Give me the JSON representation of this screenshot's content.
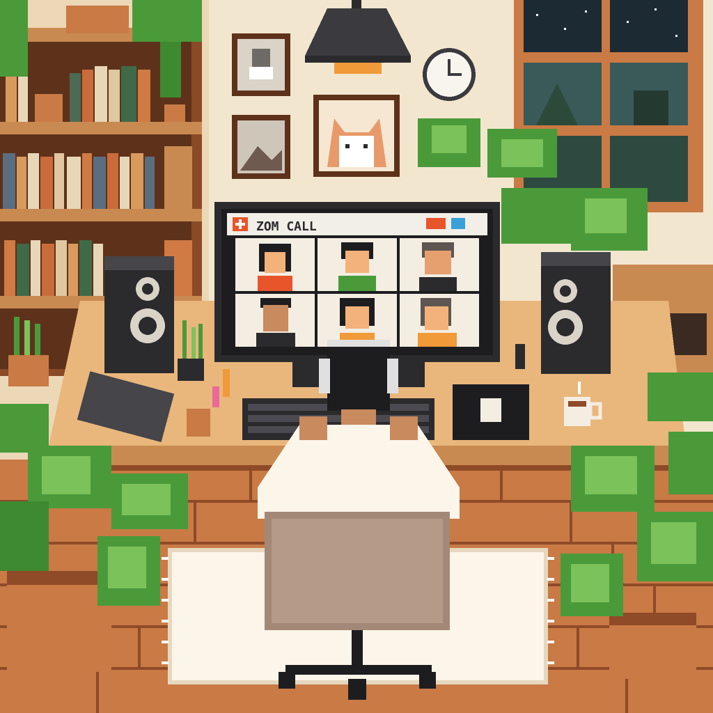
{
  "monitor": {
    "window_title": "ZOM CALL",
    "participant_count": 6
  },
  "colors": {
    "wall": "#f3e6cf",
    "floor": "#c97a45",
    "floor_line": "#8f4a28",
    "wood_dark": "#a0582e",
    "wood_light": "#d99a5e",
    "desk_top": "#e9b77c",
    "plant_green": "#4a9a3a",
    "plant_light": "#7cc25a",
    "screen_frame": "#2b2b2e",
    "call_accent": "#e8552b",
    "night_sky": "#1c2a33"
  },
  "icons": {
    "app_logo": "plus-icon",
    "window_controls": [
      "minimize-icon",
      "maximize-icon"
    ]
  }
}
